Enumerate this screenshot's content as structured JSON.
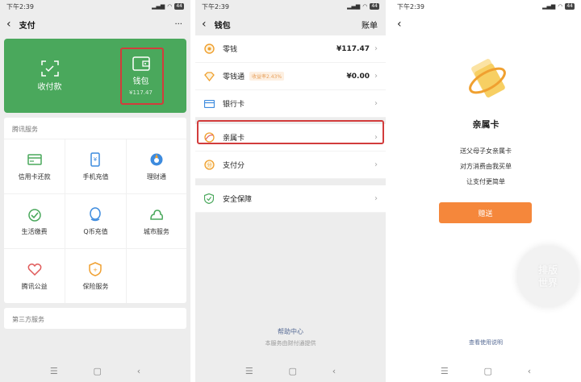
{
  "panel1": {
    "status": {
      "time": "下午2:39",
      "battery": "44"
    },
    "nav": {
      "title": "支付",
      "more": "···"
    },
    "card": {
      "collect_label": "收付款",
      "wallet_label": "钱包",
      "wallet_balance": "¥117.47",
      "color": "#4aa85c"
    },
    "tencent": {
      "title": "腾讯服务",
      "items": [
        {
          "label": "信用卡还款",
          "icon": "credit-card-icon",
          "color": "#4aa85c"
        },
        {
          "label": "手机充值",
          "icon": "phone-recharge-icon",
          "color": "#3d8bde"
        },
        {
          "label": "理财通",
          "icon": "licaitong-icon",
          "color": "#3d8bde"
        },
        {
          "label": "生活缴费",
          "icon": "life-payment-icon",
          "color": "#4aa85c"
        },
        {
          "label": "Q币充值",
          "icon": "qcoin-icon",
          "color": "#3d8bde"
        },
        {
          "label": "城市服务",
          "icon": "city-service-icon",
          "color": "#4aa85c"
        },
        {
          "label": "腾讯公益",
          "icon": "charity-icon",
          "color": "#e05a5a"
        },
        {
          "label": "保险服务",
          "icon": "insurance-icon",
          "color": "#f0a030"
        },
        {
          "label": "",
          "icon": "",
          "color": ""
        }
      ]
    },
    "third": {
      "title": "第三方服务"
    }
  },
  "panel2": {
    "status": {
      "time": "下午2:39",
      "battery": "44"
    },
    "nav": {
      "title": "钱包",
      "right": "账单"
    },
    "rows": {
      "change": {
        "label": "零钱",
        "value": "¥117.47"
      },
      "lqt": {
        "label": "零钱通",
        "badge": "收益率2.43%",
        "value": "¥0.00"
      },
      "bank": {
        "label": "银行卡"
      },
      "family": {
        "label": "亲属卡"
      },
      "score": {
        "label": "支付分"
      },
      "security": {
        "label": "安全保障"
      }
    },
    "help": "帮助中心",
    "note": "本服务由财付通提供"
  },
  "panel3": {
    "status": {
      "time": "下午2:39",
      "battery": "44"
    },
    "title": "亲属卡",
    "desc": [
      "送父母子女亲属卡",
      "对方消费由我买单",
      "让支付更简单"
    ],
    "button": "赠送",
    "usage": "查看使用说明",
    "watermark": [
      "排版",
      "世界"
    ],
    "accent": "#f5873b"
  },
  "sysnav": {
    "menu": "☰",
    "home": "▢",
    "back": "‹"
  }
}
